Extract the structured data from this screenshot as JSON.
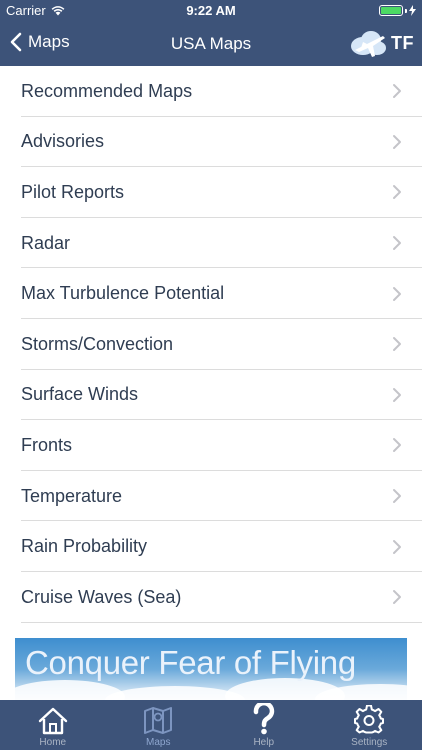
{
  "status_bar": {
    "carrier": "Carrier",
    "time": "9:22 AM",
    "battery_color": "#4cd964"
  },
  "nav": {
    "back_label": "Maps",
    "title": "USA Maps",
    "logo_text": "TF",
    "bar_color": "#3d5379"
  },
  "list": {
    "items": [
      {
        "label": "Recommended Maps"
      },
      {
        "label": "Advisories"
      },
      {
        "label": "Pilot Reports"
      },
      {
        "label": "Radar"
      },
      {
        "label": "Max Turbulence Potential"
      },
      {
        "label": "Storms/Convection"
      },
      {
        "label": "Surface Winds"
      },
      {
        "label": "Fronts"
      },
      {
        "label": "Temperature"
      },
      {
        "label": "Rain Probability"
      },
      {
        "label": "Cruise Waves (Sea)"
      }
    ]
  },
  "banner": {
    "text": "Conquer Fear of Flying"
  },
  "tabbar": {
    "tabs": [
      {
        "label": "Home",
        "icon": "home-icon"
      },
      {
        "label": "Maps",
        "icon": "map-icon",
        "active": true
      },
      {
        "label": "Help",
        "icon": "question-icon"
      },
      {
        "label": "Settings",
        "icon": "gear-icon"
      }
    ]
  }
}
